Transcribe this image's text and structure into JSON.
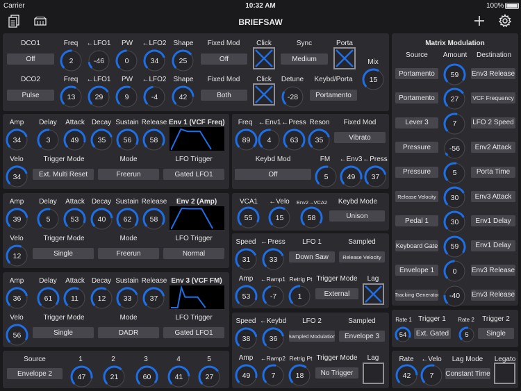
{
  "status": {
    "carrier": "Carrier",
    "time": "10:32 AM",
    "battery": "100%"
  },
  "app": {
    "title": "BRIEFSAW"
  },
  "dco1": {
    "label": "DCO1",
    "button": "Off",
    "freq_label": "Freq",
    "freq": "2",
    "lfo1_label": "←LFO1",
    "lfo1": "-46",
    "pw_label": "PW",
    "pw": "0",
    "lfo2_label": "←LFO2",
    "lfo2": "34",
    "shape_label": "Shape",
    "shape": "25",
    "fixedmod_label": "Fixed Mod",
    "fixedmod": "Off",
    "click_label": "Click",
    "sync_label": "Sync",
    "sync": "Medium",
    "porta_label": "Porta"
  },
  "mix": {
    "label": "Mix",
    "value": "15"
  },
  "dco2": {
    "label": "DCO2",
    "button": "Pulse",
    "freq_label": "Freq",
    "freq": "13",
    "lfo1_label": "←LFO1",
    "lfo1": "29",
    "pw_label": "PW",
    "pw": "9",
    "lfo2_label": "←LFO2",
    "lfo2": "-4",
    "shape_label": "Shape",
    "shape": "42",
    "fixedmod_label": "Fixed Mod",
    "fixedmod": "Both",
    "click_label": "Click",
    "detune_label": "Detune",
    "detune": "-28",
    "keybd_label": "Keybd/Porta",
    "keybd": "Portamento"
  },
  "env1": {
    "title": "Env 1 (VCF Freq)",
    "amp_label": "Amp",
    "amp": "34",
    "delay_label": "Delay",
    "delay": "3",
    "attack_label": "Attack",
    "attack": "49",
    "decay_label": "Decay",
    "decay": "35",
    "sustain_label": "Sustain",
    "sustain": "56",
    "release_label": "Release",
    "release": "58",
    "velo_label": "Velo",
    "velo": "34",
    "trigger_label": "Trigger Mode",
    "trigger": "Ext. Multi Reset",
    "mode_label": "Mode",
    "mode": "Freerun",
    "lfotrig_label": "LFO Trigger",
    "lfotrig": "Gated LFO1"
  },
  "env2": {
    "title": "Env 2 (Amp)",
    "amp_label": "Amp",
    "amp": "39",
    "delay_label": "Delay",
    "delay": "5",
    "attack_label": "Attack",
    "attack": "53",
    "decay_label": "Decay",
    "decay": "40",
    "sustain_label": "Sustain",
    "sustain": "62",
    "release_label": "Release",
    "release": "58",
    "velo_label": "Velo",
    "velo": "12",
    "trigger_label": "Trigger Mode",
    "trigger": "Single",
    "mode_label": "Mode",
    "mode": "Freerun",
    "lfotrig_label": "LFO Trigger",
    "lfotrig": "Normal"
  },
  "env3": {
    "title": "Env 3 (VCF FM)",
    "amp_label": "Amp",
    "amp": "36",
    "delay_label": "Delay",
    "delay": "61",
    "attack_label": "Attack",
    "attack": "11",
    "decay_label": "Decay",
    "decay": "12",
    "sustain_label": "Sustain",
    "sustain": "33",
    "release_label": "Release",
    "release": "37",
    "velo_label": "Velo",
    "velo": "56",
    "trigger_label": "Trigger Mode",
    "trigger": "Single",
    "mode_label": "Mode",
    "mode": "DADR",
    "lfotrig_label": "LFO Trigger",
    "lfotrig": "Gated LFO1"
  },
  "source": {
    "label": "Source",
    "value": "Envelope 2",
    "l1": "1",
    "v1": "47",
    "l2": "2",
    "v2": "21",
    "l3": "3",
    "v3": "60",
    "l4": "4",
    "v4": "41",
    "l5": "5",
    "v5": "27"
  },
  "vcf": {
    "freq_label": "Freq",
    "freq": "89",
    "env1_label": "←Env1",
    "env1": "4",
    "press_label": "←Press",
    "press": "63",
    "reson_label": "Reson",
    "reson": "35",
    "fixedmod_label": "Fixed Mod",
    "fixedmod": "Vibrato",
    "keybdmod_label": "Keybd Mod",
    "keybdmod": "Off",
    "fm_label": "FM",
    "fm": "5",
    "env3_label": "←Env3",
    "env3": "49",
    "press2_label": "←Press",
    "press2": "37"
  },
  "vca": {
    "label": "VCA1",
    "value": "55",
    "velo_label": "←Velo",
    "velo": "15",
    "env2_label": "Env2→VCA2",
    "env2": "58",
    "keybdmode_label": "Keybd Mode",
    "keybdmode": "Unison"
  },
  "lfo1": {
    "speed_label": "Speed",
    "speed": "31",
    "press_label": "←Press",
    "press": "33",
    "title": "LFO 1",
    "wave": "Down Saw",
    "sampled_label": "Sampled",
    "sampled": "Release Velocity",
    "amp_label": "Amp",
    "amp": "53",
    "ramp_label": "←Ramp1",
    "ramp": "-7",
    "retrig_label": "Retrig Pt",
    "retrig": "1",
    "trigmode_label": "Trigger Mode",
    "trigmode": "External",
    "lag_label": "Lag"
  },
  "lfo2": {
    "speed_label": "Speed",
    "speed": "38",
    "keybd_label": "←Keybd",
    "keybd": "36",
    "title": "LFO 2",
    "wave": "Sampled Modulation",
    "sampled_label": "Sampled",
    "sampled": "Envelope 3",
    "amp_label": "Amp",
    "amp": "49",
    "ramp_label": "←Ramp2",
    "ramp": "7",
    "retrig_label": "Retrig Pt",
    "retrig": "18",
    "trigmode_label": "Trigger Mode",
    "trigmode": "No Trigger",
    "lag_label": "Lag"
  },
  "matrix": {
    "title": "Matrix Modulation",
    "source_label": "Source",
    "amount_label": "Amount",
    "dest_label": "Destination",
    "rows": [
      {
        "source": "Portamento",
        "amount": "59",
        "dest": "Env3 Release"
      },
      {
        "source": "Portamento",
        "amount": "27",
        "dest": "VCF Frequency"
      },
      {
        "source": "Lever 3",
        "amount": "7",
        "dest": "LFO 2 Speed"
      },
      {
        "source": "Pressure",
        "amount": "-56",
        "dest": "Env2 Attack"
      },
      {
        "source": "Pressure",
        "amount": "5",
        "dest": "Porta Time"
      },
      {
        "source": "Release Velocity",
        "amount": "30",
        "dest": "Env3 Attack"
      },
      {
        "source": "Pedal 1",
        "amount": "30",
        "dest": "Env1 Delay"
      },
      {
        "source": "Keyboard Gate",
        "amount": "59",
        "dest": "Env1 Delay"
      },
      {
        "source": "Envelope 1",
        "amount": "0",
        "dest": "Env3 Release"
      },
      {
        "source": "Tracking Generator",
        "amount": "-40",
        "dest": "Env3 Release"
      }
    ]
  },
  "ramps": {
    "rate1_label": "Rate 1",
    "rate1": "54",
    "trigger1_label": "Trigger 1",
    "trigger1": "Ext. Gated",
    "rate2_label": "Rate 2",
    "rate2": "5",
    "trigger2_label": "Trigger 2",
    "trigger2": "Single"
  },
  "porta": {
    "rate_label": "Rate",
    "rate": "42",
    "velo_label": "←Velo",
    "velo": "7",
    "lagmode_label": "Lag Mode",
    "lagmode": "Constant Time",
    "legato_label": "Legato"
  },
  "colors": {
    "accent": "#1e6fe6",
    "panel": "#2b2b30",
    "background": "#1a1a1d",
    "button": "#46464c"
  }
}
